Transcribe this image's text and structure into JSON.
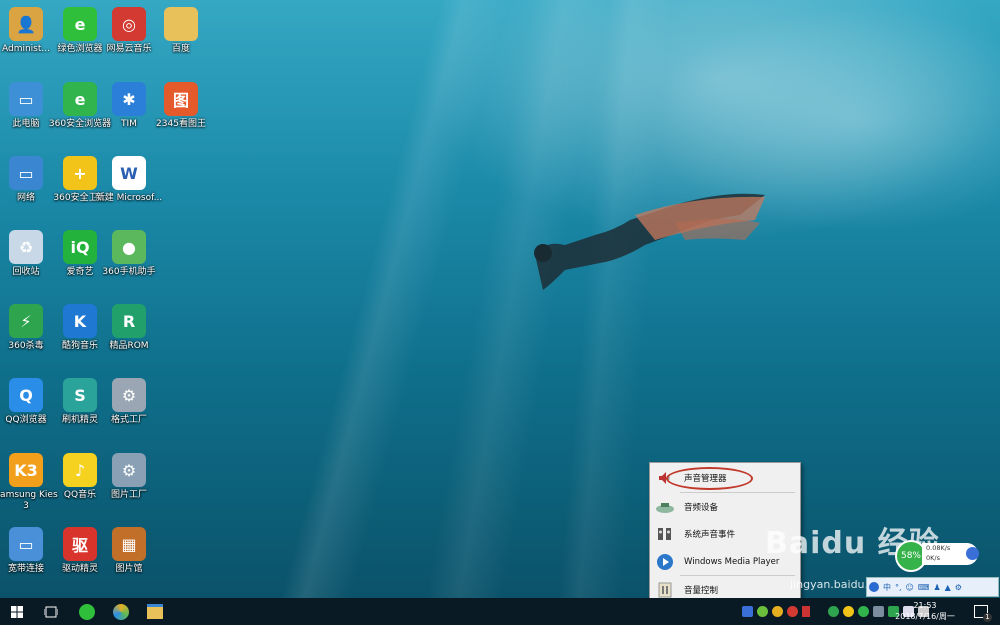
{
  "desktop_icons": [
    {
      "label": "Administ...",
      "name": "desktop-icon-administrator",
      "color": "#d9a441",
      "glyph": "👤"
    },
    {
      "label": "绿色浏览器",
      "name": "desktop-icon-green-browser",
      "color": "#2fbf3a",
      "glyph": "e"
    },
    {
      "label": "网易云音乐",
      "name": "desktop-icon-netease-music",
      "color": "#d33a31",
      "glyph": "◎"
    },
    {
      "label": "百度",
      "name": "desktop-icon-baidu-folder",
      "color": "#e8c15a",
      "glyph": ""
    },
    {
      "label": "此电脑",
      "name": "desktop-icon-this-pc",
      "color": "#3d8fd6",
      "glyph": "▭"
    },
    {
      "label": "360安全浏览器",
      "name": "desktop-icon-360-browser",
      "color": "#31b44b",
      "glyph": "e"
    },
    {
      "label": "TIM",
      "name": "desktop-icon-tim",
      "color": "#2c7fd8",
      "glyph": "✱"
    },
    {
      "label": "2345看图王",
      "name": "desktop-icon-2345-viewer",
      "color": "#e55a2b",
      "glyph": "图"
    },
    {
      "label": "网络",
      "name": "desktop-icon-network",
      "color": "#3a86d1",
      "glyph": "▭"
    },
    {
      "label": "360安全卫士",
      "name": "desktop-icon-360-safe",
      "color": "#f2c318",
      "glyph": "+"
    },
    {
      "label": "新建 Microsof...",
      "name": "desktop-icon-new-word-doc",
      "color": "#ffffff",
      "glyph": "W"
    },
    {
      "label": "回收站",
      "name": "desktop-icon-recycle-bin",
      "color": "#c8d8e6",
      "glyph": "♻"
    },
    {
      "label": "爱奇艺",
      "name": "desktop-icon-iqiyi",
      "color": "#23b33c",
      "glyph": "iQ"
    },
    {
      "label": "360手机助手",
      "name": "desktop-icon-360-mobile",
      "color": "#5cb85c",
      "glyph": "●"
    },
    {
      "label": "360杀毒",
      "name": "desktop-icon-360-antivirus",
      "color": "#2ea44f",
      "glyph": "⚡"
    },
    {
      "label": "酷狗音乐",
      "name": "desktop-icon-kugou",
      "color": "#1f78d1",
      "glyph": "K"
    },
    {
      "label": "精品ROM",
      "name": "desktop-icon-rom",
      "color": "#22a06b",
      "glyph": "R"
    },
    {
      "label": "QQ浏览器",
      "name": "desktop-icon-qq-browser",
      "color": "#2a8de8",
      "glyph": "Q"
    },
    {
      "label": "刷机精灵",
      "name": "desktop-icon-flash-wizard",
      "color": "#2aa39a",
      "glyph": "S"
    },
    {
      "label": "格式工厂",
      "name": "desktop-icon-format-factory",
      "color": "#9aa6b3",
      "glyph": "⚙"
    },
    {
      "label": "Samsung Kies 3",
      "name": "desktop-icon-samsung-kies",
      "color": "#f2a01c",
      "glyph": "K3"
    },
    {
      "label": "QQ音乐",
      "name": "desktop-icon-qq-music",
      "color": "#f5d21f",
      "glyph": "♪"
    },
    {
      "label": "图片工厂",
      "name": "desktop-icon-picture-factory",
      "color": "#8aa0b5",
      "glyph": "⚙"
    },
    {
      "label": "宽带连接",
      "name": "desktop-icon-broadband",
      "color": "#4a90d9",
      "glyph": "▭"
    },
    {
      "label": "驱动精灵",
      "name": "desktop-icon-driver-wizard",
      "color": "#d8342b",
      "glyph": "驱"
    },
    {
      "label": "图片馆",
      "name": "desktop-icon-picture-hall",
      "color": "#c26f2a",
      "glyph": "▦"
    }
  ],
  "context_menu": {
    "items": [
      {
        "label": "声音管理器",
        "icon": "speaker-icon"
      },
      {
        "label": "音频设备",
        "icon": "audio-device-icon"
      },
      {
        "label": "系统声音事件",
        "icon": "sound-events-icon"
      },
      {
        "label": "Windows Media Player",
        "icon": "media-player-icon"
      },
      {
        "label": "音量控制",
        "icon": "volume-control-icon"
      }
    ]
  },
  "net_widget": {
    "percent": "58%",
    "up": "0.08K/s",
    "down": "0K/s"
  },
  "ime_bar": {
    "mode": "中"
  },
  "clock": {
    "time": "21:53",
    "date": "2018/7/16/周一"
  },
  "watermark": {
    "logo": "Baidu 经验",
    "url": "jingyan.baidu.com"
  },
  "notification_count": "1",
  "accent_color": "#c0392b"
}
